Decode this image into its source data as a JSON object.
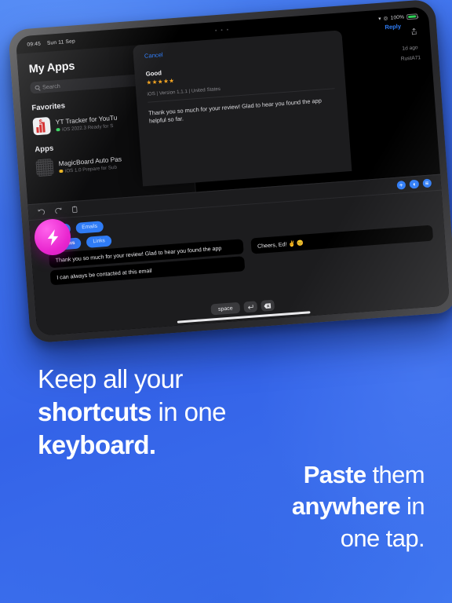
{
  "device": {
    "statusbar": {
      "time": "09:45",
      "date": "Sun 11 Sep",
      "wifi_icon": "wifi-icon",
      "lock_icon": "lock-icon",
      "battery_percent": "100%"
    },
    "home_indicator": "home-indicator"
  },
  "app_list": {
    "title": "My Apps",
    "search_placeholder": "Search",
    "sections": [
      {
        "heading": "Favorites",
        "apps": [
          {
            "name": "YT Tracker for YouTu",
            "status": "iOS 2022.3 Ready for S",
            "status_color": "#2fd158"
          }
        ]
      },
      {
        "heading": "Apps",
        "apps": [
          {
            "name": "MagicBoard Auto Pas",
            "status": "iOS 1.0 Prepare for Sub",
            "status_color": "#e8b21f"
          }
        ]
      }
    ]
  },
  "review_modal": {
    "cancel_label": "Cancel",
    "reply_label": "Reply",
    "review_title": "Good",
    "stars": "★★★★★",
    "meta": "iOS | Version 1.1.1 | United States",
    "body": "Thank you so much for your review! Glad to hear you found the app helpful so far.",
    "time_ago": "1d ago",
    "author": "RustA71",
    "share_icon": "share-icon"
  },
  "keyboard": {
    "tools": [
      {
        "icon": "undo-icon"
      },
      {
        "icon": "redo-icon"
      },
      {
        "icon": "clipboard-paste-icon"
      }
    ],
    "actions": [
      {
        "icon": "plus-circle-icon",
        "glyph": "+"
      },
      {
        "icon": "tag-circle-icon",
        "glyph": "◖"
      },
      {
        "icon": "list-circle-icon",
        "glyph": "≡"
      }
    ],
    "categories": [
      {
        "label": "DMs",
        "selected": false
      },
      {
        "label": "Emails",
        "selected": false
      },
      {
        "label": "Reviews",
        "selected": true
      },
      {
        "label": "Links",
        "selected": false
      }
    ],
    "snippets": [
      {
        "text": "Thank you so much for your review! Glad to hear you found the app"
      },
      {
        "text": "I can always be contacted at this email"
      },
      {
        "text": "Cheers, Ed! ✌️ 😊"
      }
    ],
    "keys": {
      "space": "space",
      "return_icon": "return-key-icon",
      "delete_icon": "backspace-key-icon"
    }
  },
  "fab": {
    "icon": "lightning-bolt-icon",
    "color": "#e926cf"
  },
  "headline_1": {
    "line1_light": "Keep all your",
    "line2_bold": "shortcuts",
    "line2_light": " in one",
    "line3_bold": "keyboard."
  },
  "headline_2": {
    "line1_bold": "Paste",
    "line1_light": " them",
    "line2_bold": "anywhere",
    "line2_light": " in",
    "line3_light": "one tap."
  },
  "colors": {
    "background_top": "#4e86f2",
    "background_bottom": "#3463e8",
    "accent_blue": "#2f7cf6",
    "accent_pink": "#e926cf",
    "star_orange": "#f5a623"
  }
}
